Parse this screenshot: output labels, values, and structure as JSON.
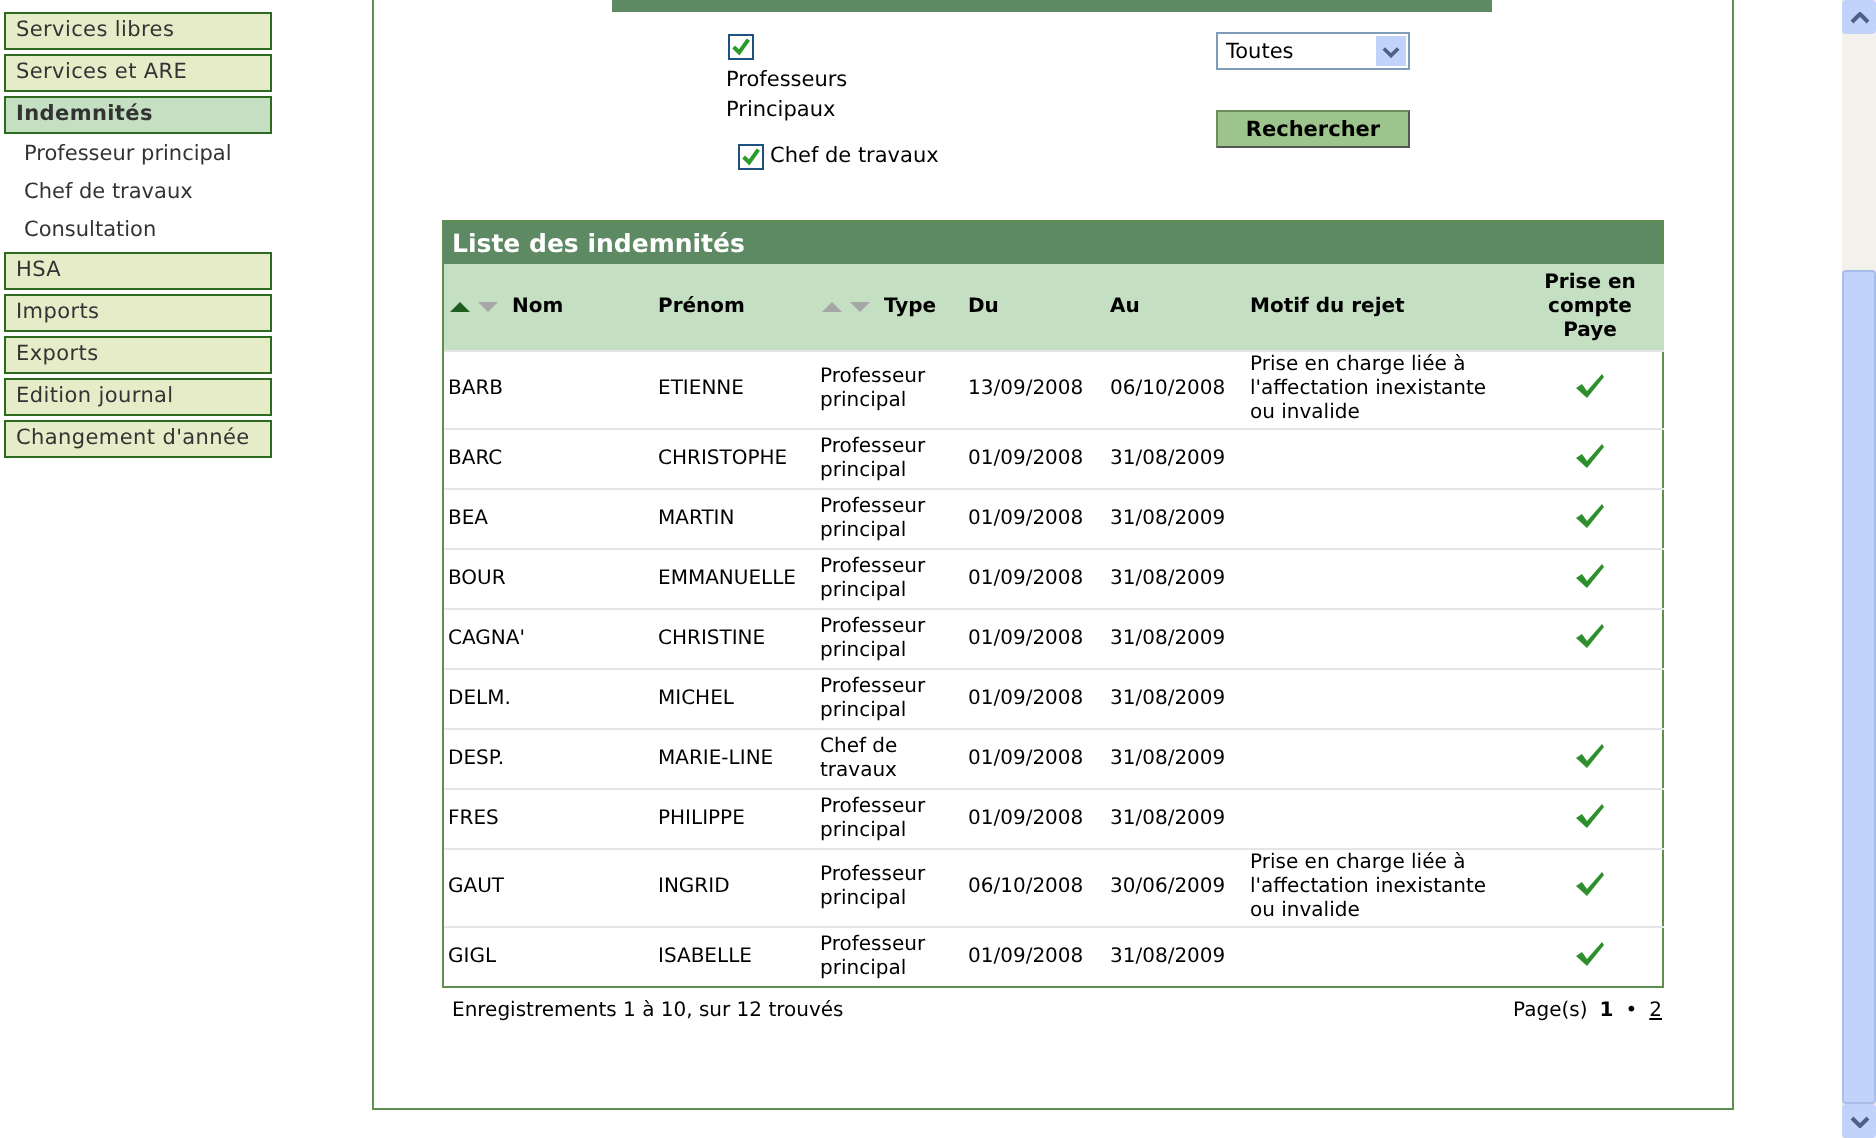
{
  "sidebar": {
    "items": [
      {
        "label": "Services libres",
        "selected": false
      },
      {
        "label": "Services et ARE",
        "selected": false
      },
      {
        "label": "Indemnités",
        "selected": true,
        "children": [
          {
            "label": "Professeur principal"
          },
          {
            "label": "Chef de travaux"
          },
          {
            "label": "Consultation"
          }
        ]
      },
      {
        "label": "HSA",
        "selected": false
      },
      {
        "label": "Imports",
        "selected": false
      },
      {
        "label": "Exports",
        "selected": false
      },
      {
        "label": "Edition journal",
        "selected": false
      },
      {
        "label": "Changement d'année",
        "selected": false
      }
    ]
  },
  "criteria": {
    "checkboxes": [
      {
        "label": "Professeurs Principaux",
        "checked": true
      },
      {
        "label": "Chef de travaux",
        "checked": true
      }
    ],
    "select": {
      "value": "Toutes"
    },
    "button": "Rechercher"
  },
  "table": {
    "title": "Liste des indemnités",
    "columns": [
      {
        "label": "Nom",
        "sortable": true,
        "sorted_ascending": true
      },
      {
        "label": "Prénom",
        "sortable": false
      },
      {
        "label": "Type",
        "sortable": true,
        "sorted_ascending": false
      },
      {
        "label": "Du",
        "sortable": false
      },
      {
        "label": "Au",
        "sortable": false
      },
      {
        "label": "Motif du rejet",
        "sortable": false
      },
      {
        "label": "Prise en compte Paye",
        "sortable": false
      }
    ],
    "rows": [
      {
        "nom": "BARB",
        "prenom": "ETIENNE",
        "type": "Professeur principal",
        "du": "13/09/2008",
        "au": "06/10/2008",
        "motif": "Prise en charge liée à l'affectation inexistante ou invalide",
        "paye": true
      },
      {
        "nom": "BARC",
        "prenom": "CHRISTOPHE",
        "type": "Professeur principal",
        "du": "01/09/2008",
        "au": "31/08/2009",
        "motif": "",
        "paye": true
      },
      {
        "nom": "BEA",
        "prenom": "MARTIN",
        "type": "Professeur principal",
        "du": "01/09/2008",
        "au": "31/08/2009",
        "motif": "",
        "paye": true
      },
      {
        "nom": "BOUR",
        "prenom": "EMMANUELLE",
        "type": "Professeur principal",
        "du": "01/09/2008",
        "au": "31/08/2009",
        "motif": "",
        "paye": true
      },
      {
        "nom": "CAGNA'",
        "prenom": "CHRISTINE",
        "type": "Professeur principal",
        "du": "01/09/2008",
        "au": "31/08/2009",
        "motif": "",
        "paye": true
      },
      {
        "nom": "DELM.",
        "prenom": "MICHEL",
        "type": "Professeur principal",
        "du": "01/09/2008",
        "au": "31/08/2009",
        "motif": "",
        "paye": false
      },
      {
        "nom": "DESP.",
        "prenom": "MARIE-LINE",
        "type": "Chef de travaux",
        "du": "01/09/2008",
        "au": "31/08/2009",
        "motif": "",
        "paye": true
      },
      {
        "nom": "FRES",
        "prenom": "PHILIPPE",
        "type": "Professeur principal",
        "du": "01/09/2008",
        "au": "31/08/2009",
        "motif": "",
        "paye": true
      },
      {
        "nom": "GAUT",
        "prenom": "INGRID",
        "type": "Professeur principal",
        "du": "06/10/2008",
        "au": "30/06/2009",
        "motif": "Prise en charge liée à l'affectation inexistante ou invalide",
        "paye": true
      },
      {
        "nom": "GIGL",
        "prenom": "ISABELLE",
        "type": "Professeur principal",
        "du": "01/09/2008",
        "au": "31/08/2009",
        "motif": "",
        "paye": true
      }
    ],
    "summary": "Enregistrements 1 à 10, sur 12 trouvés",
    "pager": {
      "label": "Page(s)",
      "separator": "•",
      "pages": [
        {
          "label": "1",
          "selected": true
        },
        {
          "label": "2",
          "selected": false
        }
      ]
    }
  }
}
